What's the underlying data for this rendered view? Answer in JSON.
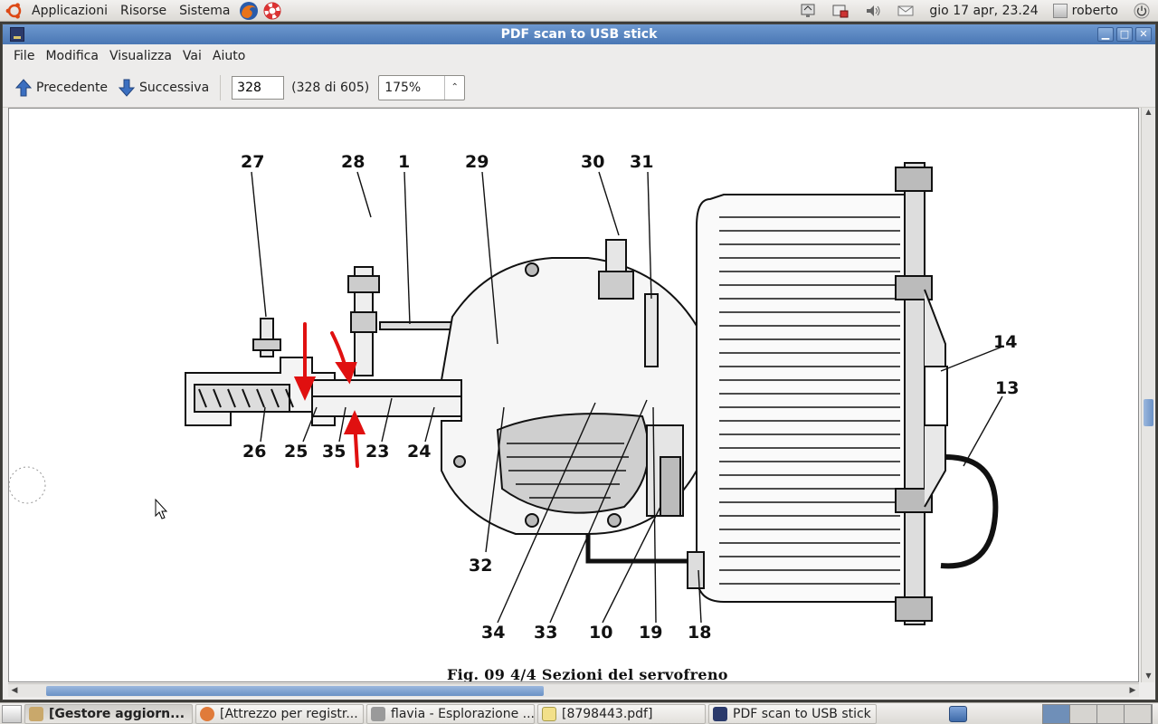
{
  "top_panel": {
    "menus": [
      "Applicazioni",
      "Risorse",
      "Sistema"
    ],
    "clock": "gio 17 apr, 23.24",
    "user": "roberto"
  },
  "window": {
    "title": "PDF scan to USB stick",
    "menu": [
      "File",
      "Modifica",
      "Visualizza",
      "Vai",
      "Aiuto"
    ],
    "toolbar": {
      "prev_label": "Precedente",
      "next_label": "Successiva",
      "page_value": "328",
      "page_count": "(328 di 605)",
      "zoom": "175%"
    },
    "document": {
      "caption": "Fig. 09 4/4 Sezioni del servofreno",
      "callouts": [
        "27",
        "28",
        "1",
        "29",
        "30",
        "31",
        "14",
        "13",
        "26",
        "25",
        "35",
        "23",
        "24",
        "32",
        "34",
        "33",
        "10",
        "19",
        "18"
      ]
    }
  },
  "taskbar": {
    "tasks": [
      {
        "label": "[Gestore aggiorn...",
        "active": true
      },
      {
        "label": "[Attrezzo per registr...",
        "active": false
      },
      {
        "label": "flavia - Esplorazione ...",
        "active": false
      },
      {
        "label": "[8798443.pdf]",
        "active": false
      },
      {
        "label": "PDF scan to USB stick",
        "active": false
      }
    ]
  },
  "colors": {
    "titlebar": "#4a77b4",
    "annotation_red": "#e01010"
  }
}
